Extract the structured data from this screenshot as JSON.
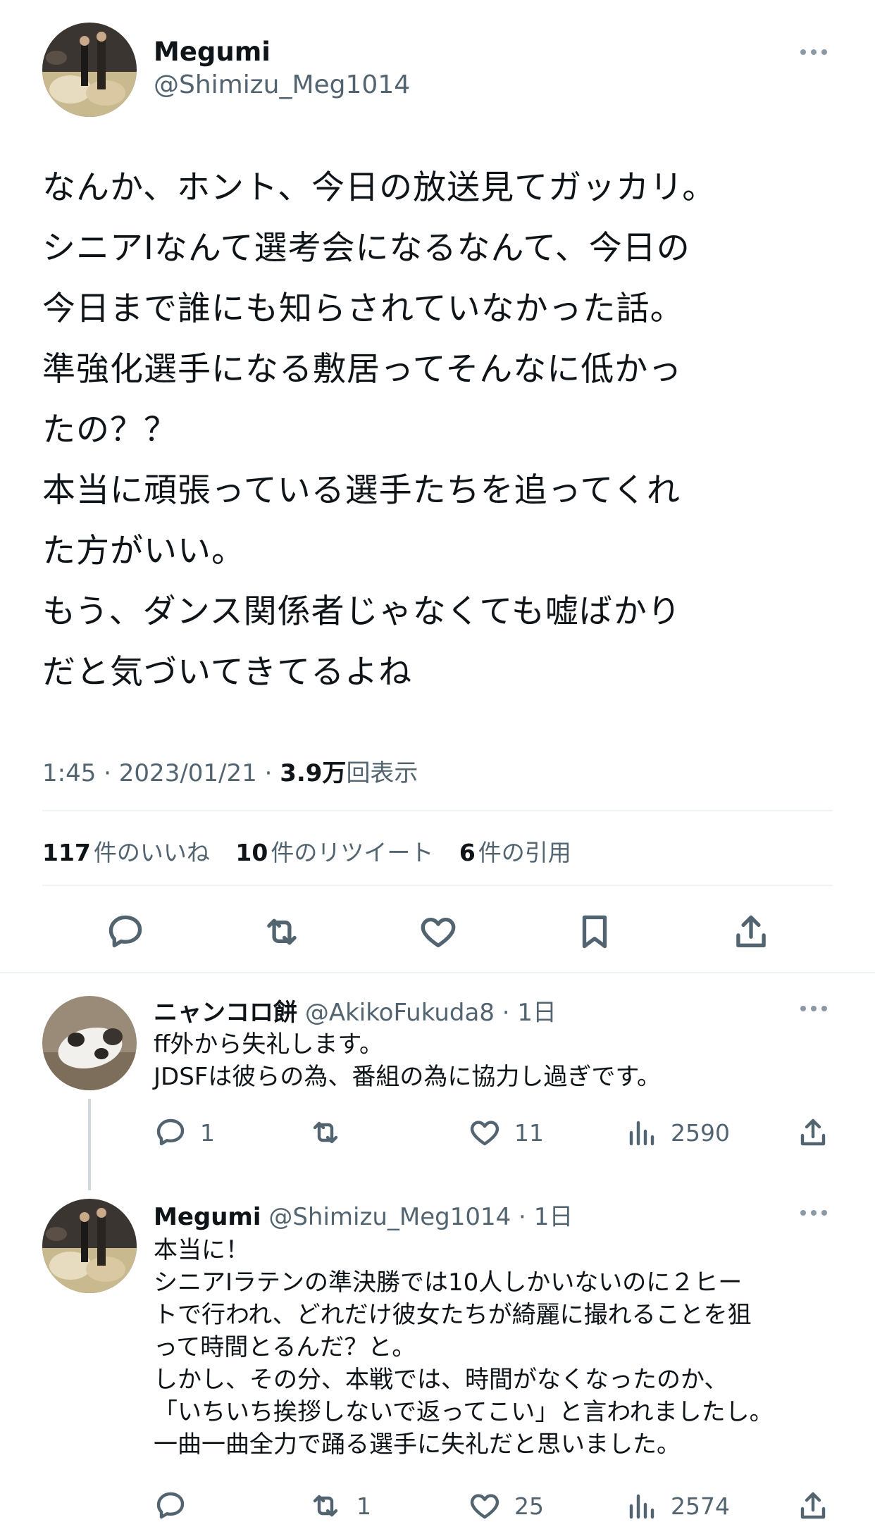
{
  "tweet": {
    "author_name": "Megumi",
    "author_handle": "@Shimizu_Meg1014",
    "lines": [
      "なんか、ホント、今日の放送見てガッカリ。",
      "シニアⅠなんて選考会になるなんて、今日の",
      "今日まで誰にも知らされていなかった話。",
      "準強化選手になる敷居ってそんなに低かっ",
      "たの？？",
      "本当に頑張っている選手たちを追ってくれ",
      "た方がいい。",
      "もう、ダンス関係者じゃなくても嘘ばかり",
      "だと気づいてきてるよね"
    ],
    "time": "1:45",
    "date": "2023/01/21",
    "views_value": "3.9万",
    "views_label": "回表示",
    "likes_count": "117",
    "likes_label": "件のいいね",
    "retweets_count": "10",
    "retweets_label": "件のリツイート",
    "quotes_count": "6",
    "quotes_label": "件の引用"
  },
  "replies": [
    {
      "name": "ニャンコロ餅",
      "handle": "@AkikoFukuda8",
      "age": "1日",
      "lines": [
        "ff外から失礼します。",
        "JDSFは彼らの為、番組の為に協力し過ぎです。"
      ],
      "reply_count": "1",
      "retweet_count": "",
      "like_count": "11",
      "view_count": "2590"
    },
    {
      "name": "Megumi",
      "handle": "@Shimizu_Meg1014",
      "age": "1日",
      "lines": [
        "本当に！",
        "シニアⅠラテンの準決勝では10人しかいないのに２ヒー",
        "トで行われ、どれだけ彼女たちが綺麗に撮れることを狙",
        "って時間とるんだ？と。",
        "しかし、その分、本戦では、時間がなくなったのか、",
        "「いちいち挨拶しないで返ってこい」と言われましたし。",
        "一曲一曲全力で踊る選手に失礼だと思いました。"
      ],
      "reply_count": "",
      "retweet_count": "1",
      "like_count": "25",
      "view_count": "2574"
    }
  ],
  "colors": {
    "text": "#0f1419",
    "secondary": "#536471",
    "divider": "#eff3f4",
    "thread_line": "#cfd9de"
  }
}
